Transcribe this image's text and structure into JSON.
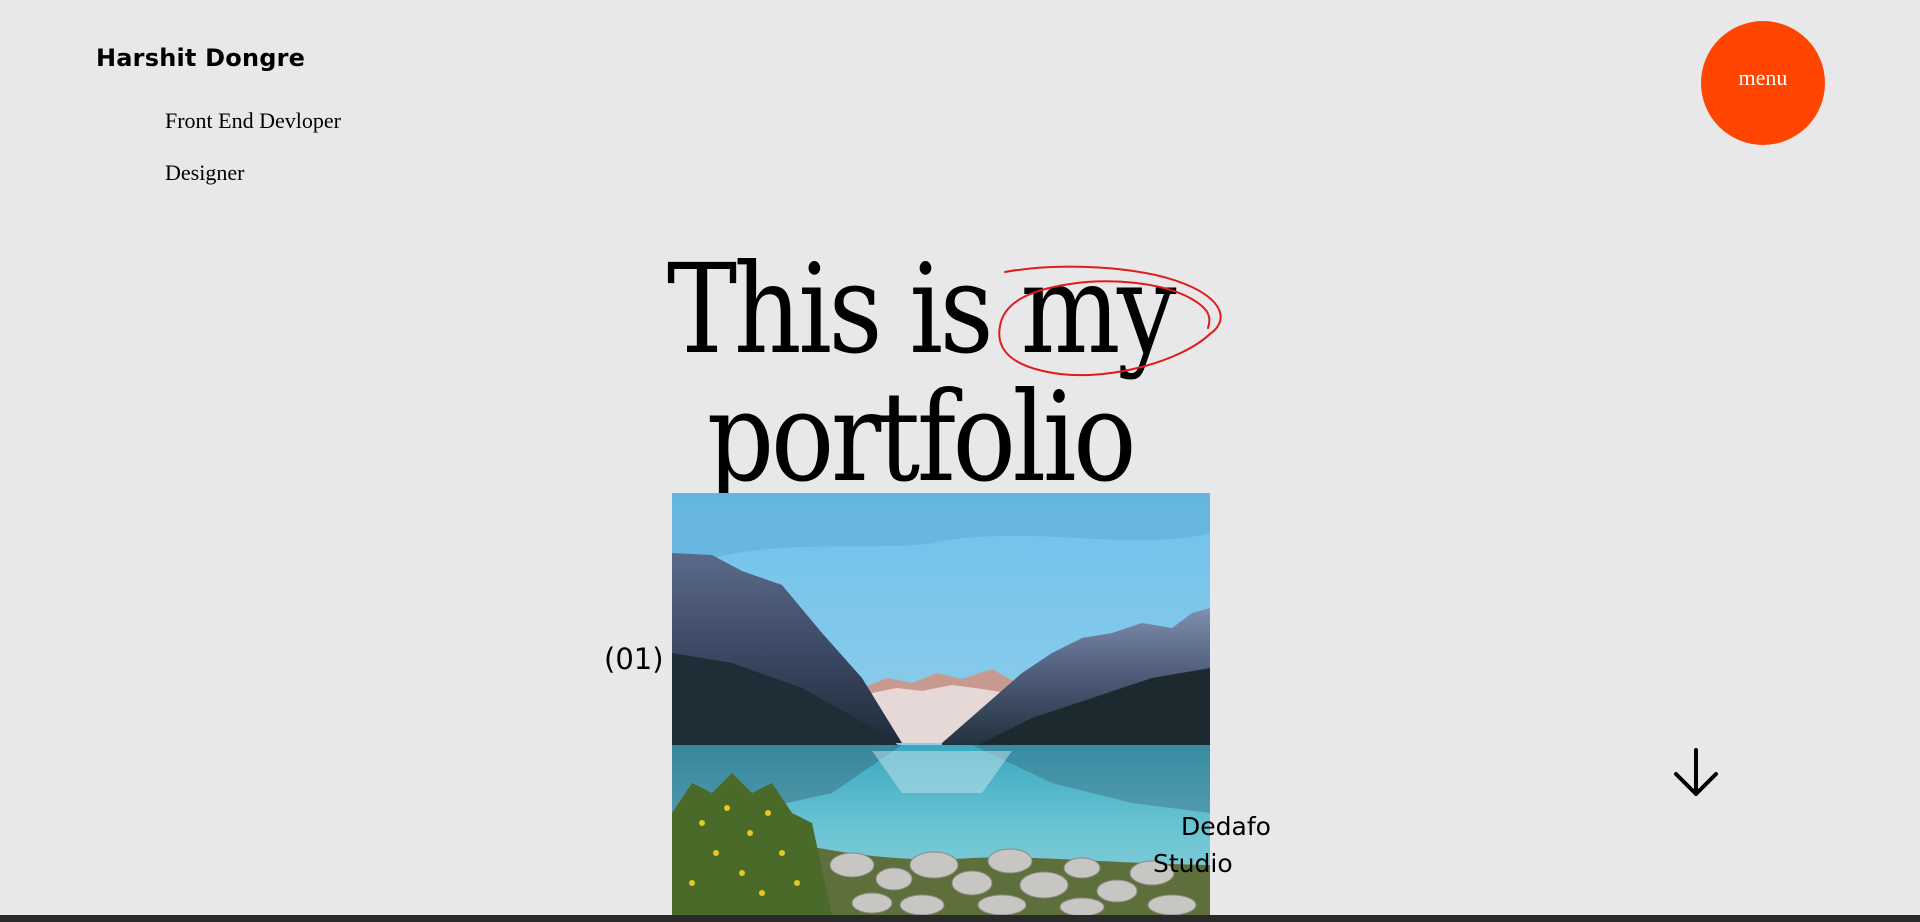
{
  "header": {
    "name": "Harshit Dongre",
    "roles": [
      "Front End Devloper",
      "Designer"
    ],
    "menu_label": "menu"
  },
  "hero": {
    "title_line1": "This is my",
    "title_line2": "portfolio",
    "highlight_word": "my"
  },
  "project": {
    "index": "(01)",
    "studio_line1": "Dedafo",
    "studio_line2": "Studio",
    "image": "mountain-lake-photo"
  },
  "icons": {
    "scroll": "arrow-down-icon",
    "scribble": "hand-drawn-circle"
  },
  "colors": {
    "background": "#e8e8ea",
    "accent": "#ff4500",
    "scribble": "#e01b1b",
    "text": "#000000"
  }
}
